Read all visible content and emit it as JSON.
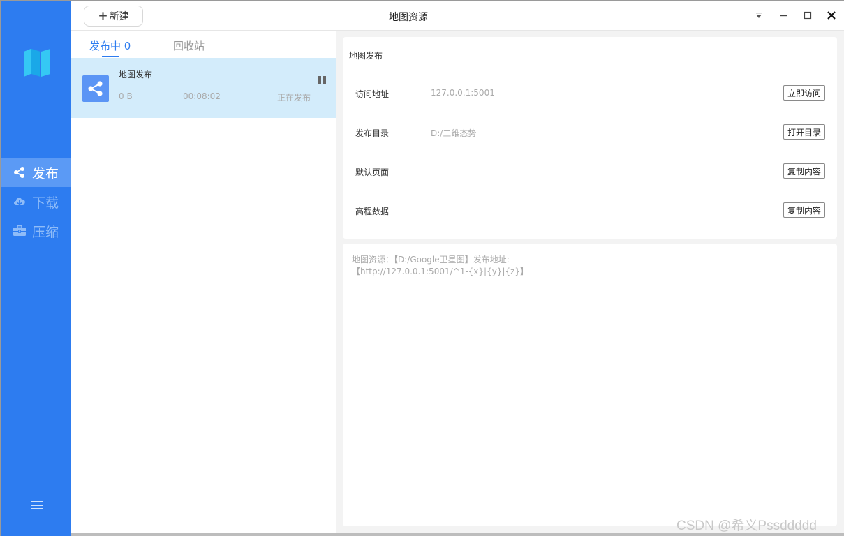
{
  "window": {
    "title": "地图资源",
    "new_button_label": "新建",
    "new_button_plus": "+"
  },
  "sidebar": {
    "items": [
      {
        "label": "发布",
        "icon": "share-icon",
        "active": true
      },
      {
        "label": "下载",
        "icon": "cloud-download-icon",
        "active": false
      },
      {
        "label": "压缩",
        "icon": "briefcase-icon",
        "active": false
      }
    ],
    "menu_icon": "hamburger-menu-icon"
  },
  "list": {
    "tabs": [
      {
        "label": "发布中 0",
        "active": true
      },
      {
        "label": "回收站",
        "active": false
      }
    ],
    "tasks": [
      {
        "name": "地图发布",
        "size": "0 B",
        "elapsed": "00:08:02",
        "status": "正在发布"
      }
    ]
  },
  "detail": {
    "title": "地图发布",
    "rows": [
      {
        "label": "访问地址",
        "value": "127.0.0.1:5001",
        "button": "立即访问"
      },
      {
        "label": "发布目录",
        "value": "D:/三维态势",
        "button": "打开目录"
      },
      {
        "label": "默认页面",
        "value": "",
        "button": "复制内容"
      },
      {
        "label": "高程数据",
        "value": "",
        "button": "复制内容"
      }
    ]
  },
  "log": {
    "lines": [
      "地图资源：【D:/Google卫星图】发布地址:",
      "【http://127.0.0.1:5001/^1-{x}|{y}|{z}】"
    ]
  },
  "watermark": "CSDN @希义Pssddddd",
  "colors": {
    "sidebar": "#2d7cf0",
    "sidebar_active": "#5b9af5",
    "task_selected": "#d3ecfb",
    "accent": "#2d7cf0"
  }
}
